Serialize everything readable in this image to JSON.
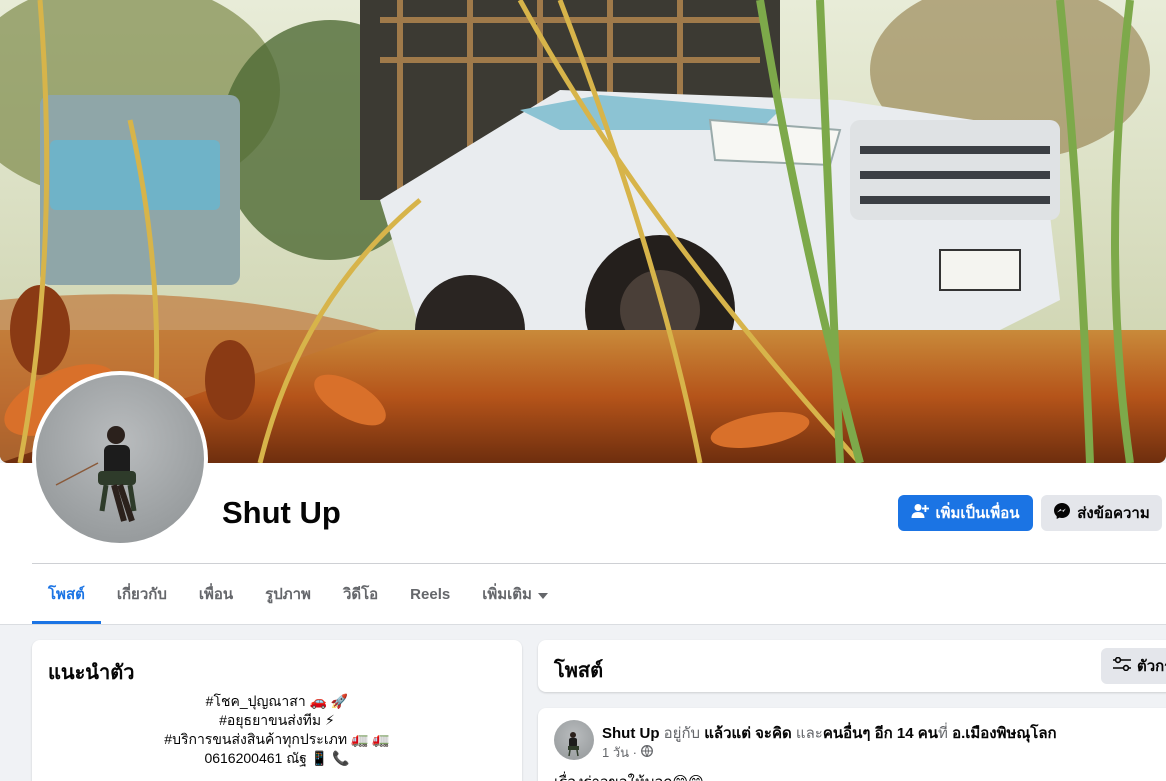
{
  "profile": {
    "name": "Shut Up",
    "add_friend_label": "เพิ่มเป็นเพื่อน",
    "message_label": "ส่งข้อความ"
  },
  "tabs": [
    {
      "label": "โพสต์"
    },
    {
      "label": "เกี่ยวกับ"
    },
    {
      "label": "เพื่อน"
    },
    {
      "label": "รูปภาพ"
    },
    {
      "label": "วิดีโอ"
    },
    {
      "label": "Reels"
    },
    {
      "label": "เพิ่มเติม"
    }
  ],
  "intro": {
    "title": "แนะนำตัว",
    "bio_lines": [
      "#โชค_ปุญณาสา 🚗 🚀",
      "#อยุธยาขนส่งทีม ⚡",
      "#บริการขนส่งสินค้าทุกประเภท 🚛 🚛",
      "0616200461 ณัฐ 📱 📞"
    ]
  },
  "posts_section": {
    "title": "โพสต์",
    "filter_label": "ตัวกรอง"
  },
  "post": {
    "author": "Shut Up",
    "with_text": "อยู่กับ",
    "tagged_person": "แล้วแต่ จะคิด",
    "and_text": "และ",
    "others": "คนอื่นๆ อีก 14 คน",
    "at_text": "ที่",
    "location": "อ.เมืองพิษณุโลก",
    "time": "1 วัน ·",
    "text": "เรื่องร่าวขอให้บอก😁😁"
  },
  "colors": {
    "accent": "#1b74e4",
    "secondary_button": "#e4e6eb",
    "background": "#f0f2f5"
  }
}
